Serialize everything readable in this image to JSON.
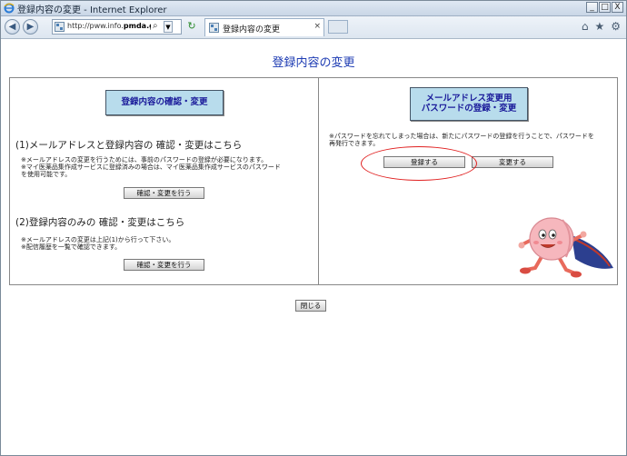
{
  "window": {
    "title": "登録内容の変更 - Internet Explorer",
    "controls": {
      "minimize": "_",
      "maximize": "□",
      "close": "X"
    }
  },
  "browser": {
    "url_prefix": "http://pww.info.",
    "url_domain": "pmda.go.jp",
    "url_suffix": "/p",
    "tab_title": "登録内容の変更",
    "tab_close": "×",
    "back_icon": "◀",
    "forward_icon": "▶",
    "search_glyph": "⌕",
    "dropdown_glyph": "▼",
    "refresh_glyph": "↻",
    "tools": {
      "home": "⌂",
      "favorites": "★",
      "settings": "⚙"
    }
  },
  "page": {
    "title": "登録内容の変更",
    "left": {
      "header": "登録内容の確認・変更",
      "section1": {
        "heading": "(1)メールアドレスと登録内容の 確認・変更はこちら",
        "notes": [
          "※メールアドレスの変更を行うためには、事前のパスワードの登録が必要になります。",
          "※マイ医薬品集作成サービスに登録済みの場合は、マイ医薬品集作成サービスのパスワード",
          "を使用可能です。"
        ],
        "button": "確認・変更を行う"
      },
      "section2": {
        "heading": "(2)登録内容のみの 確認・変更はこちら",
        "notes": [
          "※メールアドレスの変更は上記(1)から行って下さい。",
          "※配信履歴を一覧で確認できます。"
        ],
        "button": "確認・変更を行う"
      }
    },
    "right": {
      "header_line1": "メールアドレス変更用",
      "header_line2": "パスワードの登録・変更",
      "notes": [
        "※パスワードを忘れてしまった場合は、新たにパスワードの登録を行うことで、パスワードを",
        "再発行できます。"
      ],
      "register_button": "登録する",
      "change_button": "変更する"
    },
    "close_button": "閉じる"
  },
  "colors": {
    "title_blue": "#1d3bb3",
    "header_bg": "#b8dcec",
    "highlight": "#e02020"
  }
}
